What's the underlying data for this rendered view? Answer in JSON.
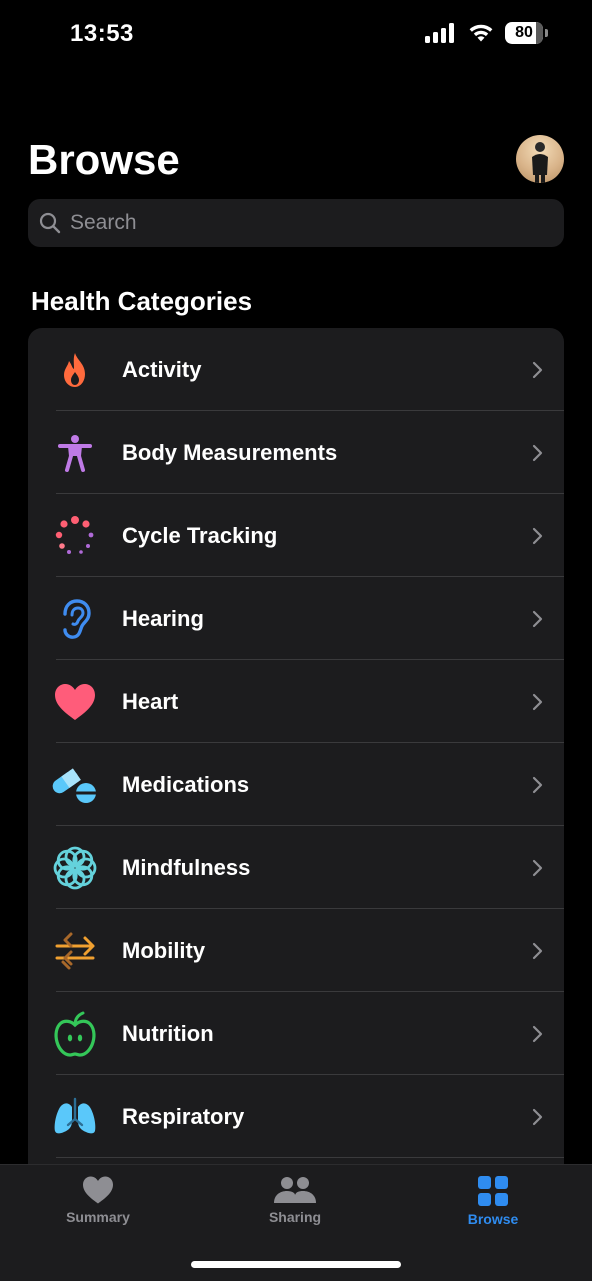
{
  "status_bar": {
    "time": "13:53",
    "battery": "80"
  },
  "header": {
    "title": "Browse"
  },
  "search": {
    "placeholder": "Search"
  },
  "section": {
    "title": "Health Categories"
  },
  "categories": [
    {
      "label": "Activity",
      "icon": "flame-icon",
      "color": "#ff6a3d"
    },
    {
      "label": "Body Measurements",
      "icon": "person-figure-icon",
      "color": "#bf7ae6"
    },
    {
      "label": "Cycle Tracking",
      "icon": "cycle-dots-icon",
      "color": "#ff5f73"
    },
    {
      "label": "Hearing",
      "icon": "ear-icon",
      "color": "#3f8cf0"
    },
    {
      "label": "Heart",
      "icon": "heart-icon",
      "color": "#ff3b5c"
    },
    {
      "label": "Medications",
      "icon": "pills-icon",
      "color": "#5ac8fa"
    },
    {
      "label": "Mindfulness",
      "icon": "flower-icon",
      "color": "#64d2dc"
    },
    {
      "label": "Mobility",
      "icon": "arrows-icon",
      "color": "#f0a030"
    },
    {
      "label": "Nutrition",
      "icon": "apple-icon",
      "color": "#34c759"
    },
    {
      "label": "Respiratory",
      "icon": "lungs-icon",
      "color": "#5ac8fa"
    }
  ],
  "tabs": [
    {
      "label": "Summary",
      "icon": "heart-icon",
      "active": false
    },
    {
      "label": "Sharing",
      "icon": "people-icon",
      "active": false
    },
    {
      "label": "Browse",
      "icon": "grid-icon",
      "active": true
    }
  ],
  "colors": {
    "accent": "#2f8cf0",
    "inactive_tab": "#8e8e93"
  }
}
